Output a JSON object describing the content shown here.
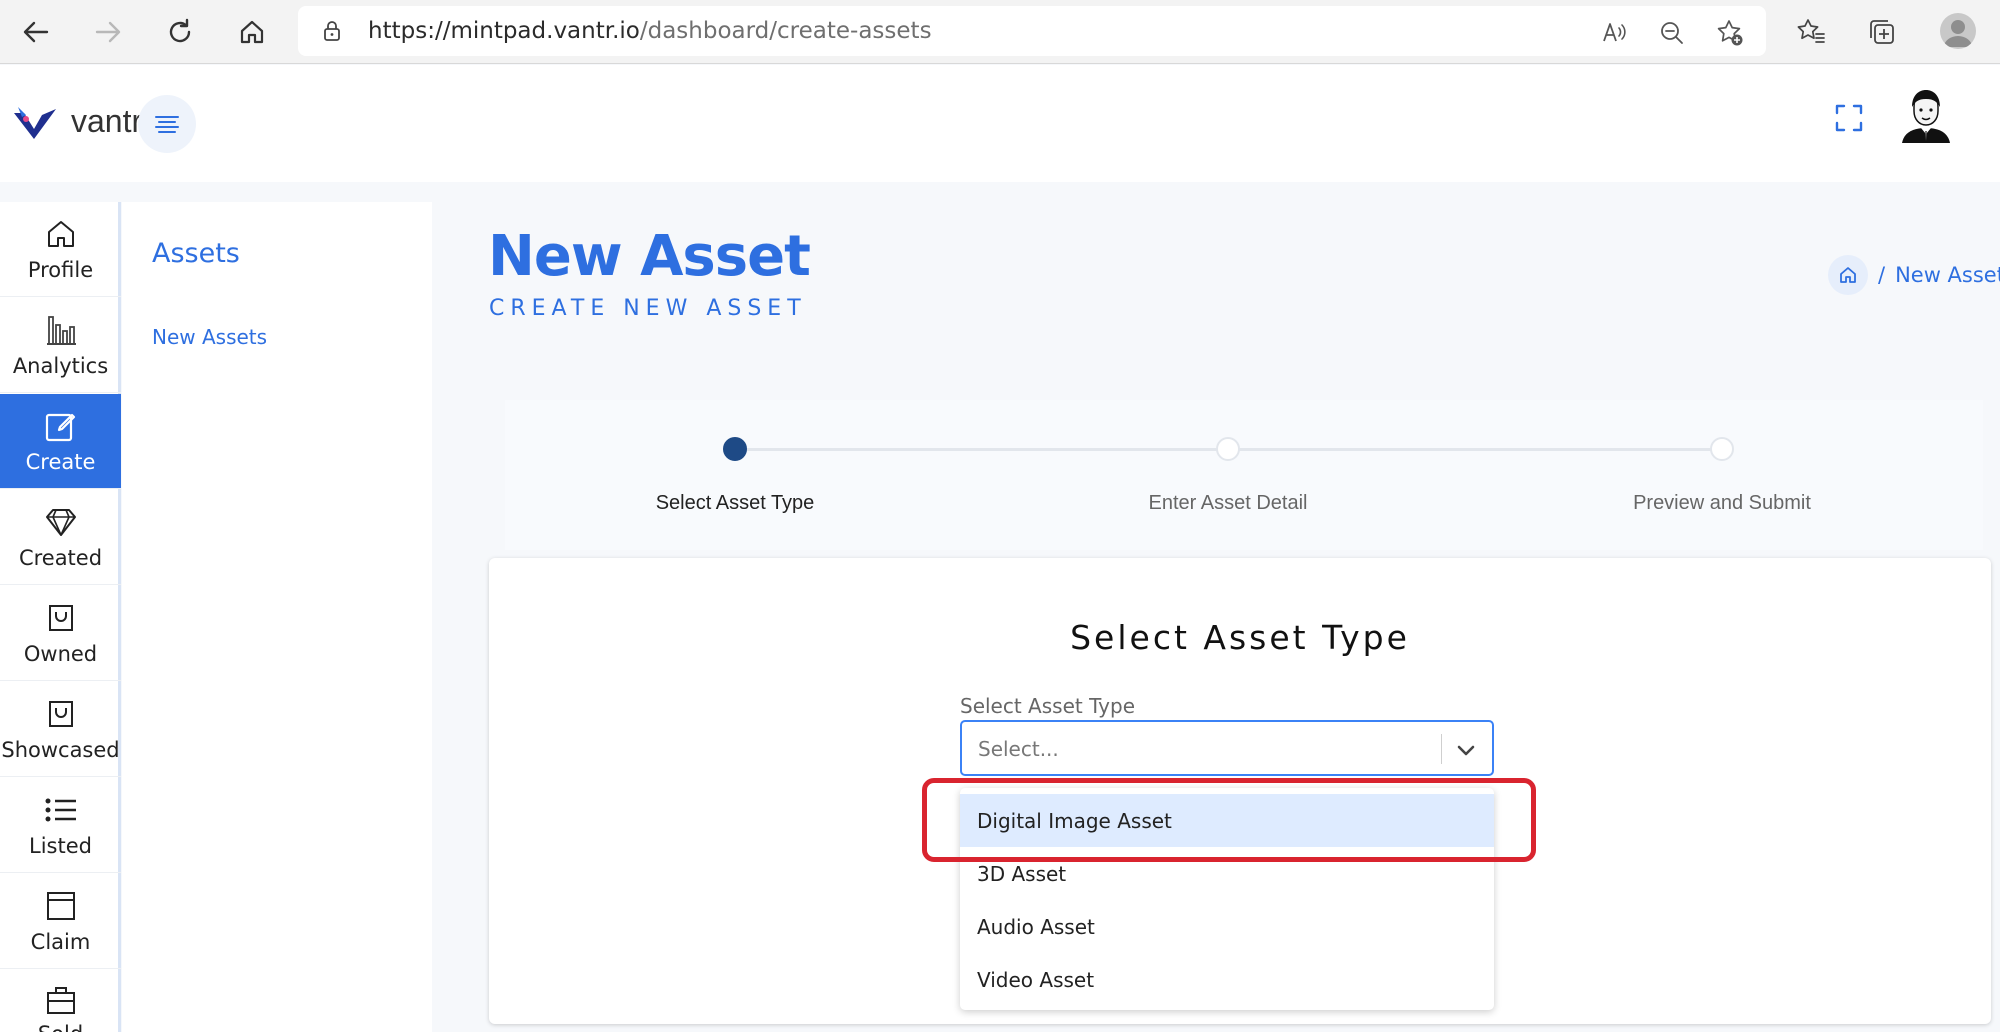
{
  "browser": {
    "url_host": "https://mintpad.vantr.io",
    "url_path": "/dashboard/create-assets"
  },
  "header": {
    "logo_text": "vantr"
  },
  "rail": {
    "items": [
      {
        "label": "Profile",
        "icon": "home-icon"
      },
      {
        "label": "Analytics",
        "icon": "bar-chart-icon"
      },
      {
        "label": "Create",
        "icon": "edit-icon",
        "active": true
      },
      {
        "label": "Created",
        "icon": "diamond-icon"
      },
      {
        "label": "Owned",
        "icon": "bag-icon"
      },
      {
        "label": "Showcased",
        "icon": "bag-icon"
      },
      {
        "label": "Listed",
        "icon": "list-icon"
      },
      {
        "label": "Claim",
        "icon": "window-icon"
      },
      {
        "label": "Sold",
        "icon": "briefcase-icon"
      }
    ]
  },
  "sub_sidebar": {
    "title": "Assets",
    "link": "New Assets"
  },
  "page": {
    "title": "New Asset",
    "subtitle": "CREATE NEW ASSET",
    "breadcrumb_sep": "/",
    "breadcrumb_current": "New Asset"
  },
  "stepper": {
    "steps": [
      {
        "label": "Select Asset Type",
        "active": true
      },
      {
        "label": "Enter Asset Detail",
        "active": false
      },
      {
        "label": "Preview and Submit",
        "active": false
      }
    ]
  },
  "card": {
    "title": "Select Asset Type",
    "field_label": "Select Asset Type",
    "placeholder": "Select...",
    "options": [
      "Digital Image Asset",
      "3D Asset",
      "Audio Asset",
      "Video Asset"
    ]
  },
  "colors": {
    "accent": "#2e6fe0",
    "highlight": "#d9242f",
    "option_hover": "#deebff"
  }
}
